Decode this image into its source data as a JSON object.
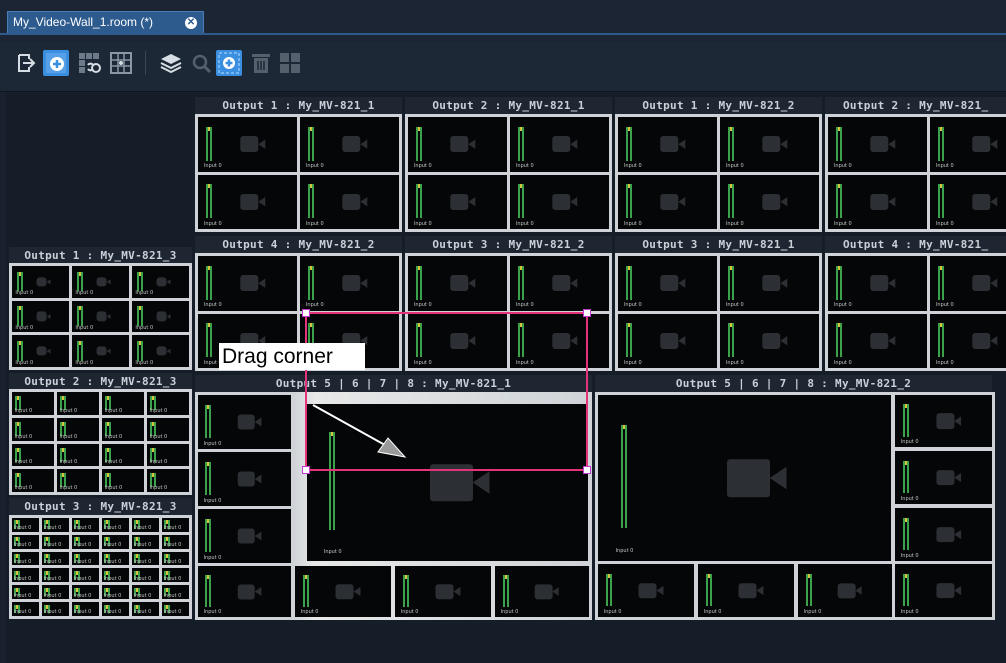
{
  "tab": {
    "title": "My_Video-Wall_1.room (*)",
    "close_icon": "close-icon"
  },
  "toolbar": {
    "buttons": [
      {
        "name": "exit-icon",
        "selected": false
      },
      {
        "name": "add-icon",
        "selected": true
      },
      {
        "name": "link-grid-icon",
        "selected": false
      },
      {
        "name": "grid-icon",
        "selected": false
      },
      {
        "name": "layers-icon",
        "selected": false
      },
      {
        "name": "search-icon",
        "selected": false
      },
      {
        "name": "add-tile-icon",
        "selected": true
      },
      {
        "name": "delete-icon",
        "selected": false
      },
      {
        "name": "layout-icon",
        "selected": false
      }
    ]
  },
  "multiviewers": {
    "top_row": [
      "Output 1 : My_MV-821_1",
      "Output 2 : My_MV-821_1",
      "Output 1 : My_MV-821_2",
      "Output 2 : My_MV-821_"
    ],
    "second_row": [
      "Output 4 : My_MV-821_2",
      "Output 3 : My_MV-821_2",
      "Output 3 : My_MV-821_1",
      "Output 4 : My_MV-821_"
    ],
    "left_column": [
      "Output 1 : My_MV-821_3",
      "Output 2 : My_MV-821_3",
      "Output 3 : My_MV-821_3"
    ],
    "big": [
      "Output 5 | 6 | 7 | 8 : My_MV-821_1",
      "Output 5 | 6 | 7 | 8 : My_MV-821_2"
    ]
  },
  "tile_label": "Input 0",
  "callout": {
    "text": "Drag corner"
  },
  "colors": {
    "accent": "#3b8fe0",
    "selection": "#e4337a",
    "handle": "#c23ad1"
  }
}
